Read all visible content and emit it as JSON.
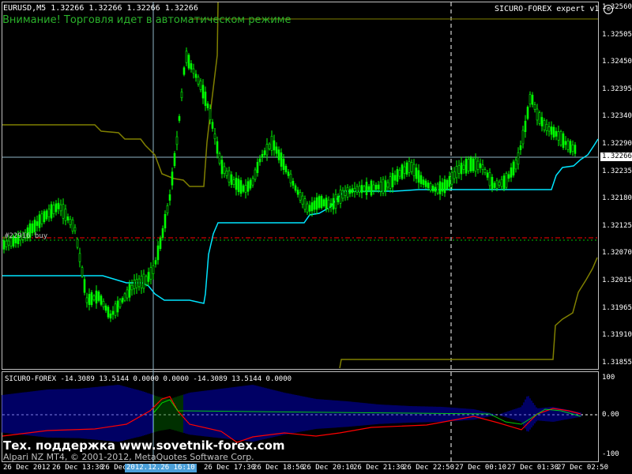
{
  "header": {
    "symbol_line": "EURUSD,M5  1.32266 1.32266 1.32266 1.32266",
    "warning": "Внимание! Торговля идет в автоматическом режиме",
    "expert_label": "SICURO-FOREX expert v1"
  },
  "main_chart": {
    "price_axis": [
      "1.32560",
      "1.32505",
      "1.32450",
      "1.32395",
      "1.32340",
      "1.32290",
      "1.32235",
      "1.32180",
      "1.32125",
      "1.32070",
      "1.32015",
      "1.31965",
      "1.31910",
      "1.31855"
    ],
    "current_price": "1.32266",
    "order_label": "#22916 buy",
    "colors": {
      "candles": "#00ff00",
      "cyan_line": "#00e5ff",
      "olive_line": "#808000",
      "order_line_red": "#ff0000",
      "order_line_green": "#00ff00"
    }
  },
  "indicator": {
    "label": "SICURO-FOREX -14.3089 13.5144 0.0000 0.0000 -14.3089 13.5144 0.0000",
    "scale": [
      "100",
      "0.00",
      "-100"
    ],
    "colors": {
      "histogram": "#0000ff",
      "line_red": "#ff0000",
      "line_green": "#00ff00"
    }
  },
  "footer": {
    "support": "Тех. поддержка www.sovetnik-forex.com",
    "copyright": "Alpari NZ MT4, © 2001-2012, MetaQuotes Software Corp."
  },
  "time_axis": [
    "26 Dec 2012",
    "26 Dec 13:30",
    "26 Dec",
    "2012.12.26 16:10",
    "26 Dec 17:30",
    "26 Dec 18:50",
    "26 Dec 20:10",
    "26 Dec 21:30",
    "26 Dec 22:50",
    "27 Dec 00:10",
    "27 Dec 01:30",
    "27 Dec 02:50"
  ]
}
